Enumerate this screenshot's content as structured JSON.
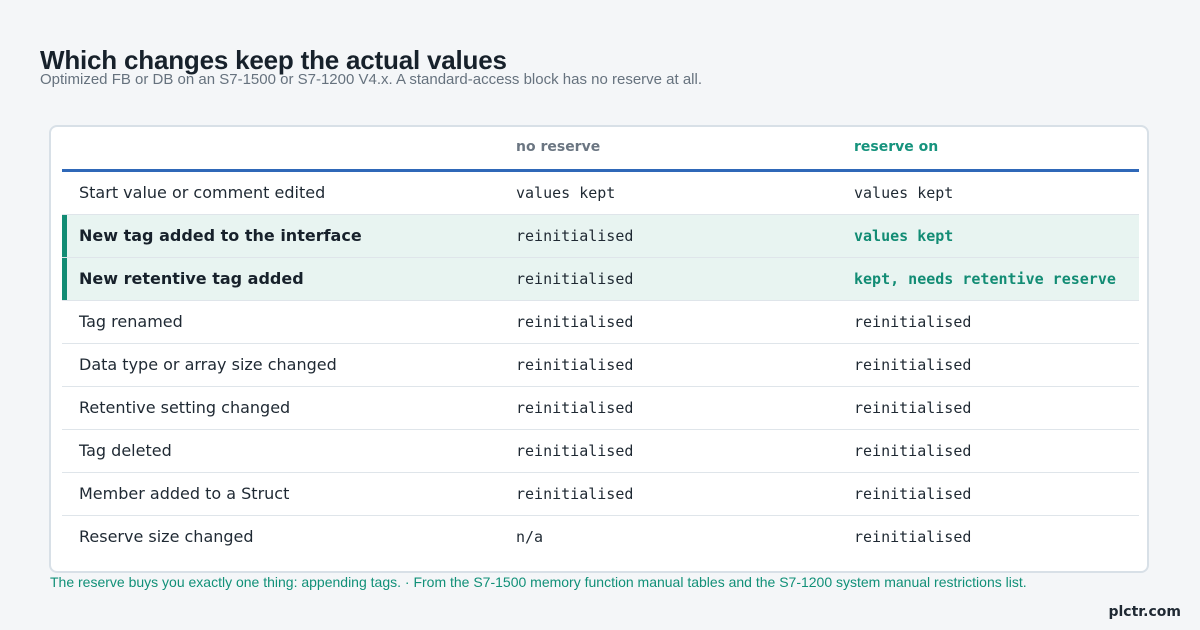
{
  "page": {
    "title": "Which changes keep the actual values",
    "subtitle": "Optimized FB or DB on an S7-1500 or S7-1200 V4.x. A standard-access block has no reserve at all.",
    "footer_note": "The reserve buys you exactly one thing: appending tags. · From the S7-1500 memory function manual tables and the S7-1200 system manual restrictions list.",
    "brand": "plctr.com"
  },
  "colors": {
    "background": "#f4f6f8",
    "card": "#ffffff",
    "header_rule": "#2f68b8",
    "accent_green": "#128c74",
    "highlight_row": "#e8f4f1",
    "muted_text": "#66727e"
  },
  "table": {
    "headers": {
      "change": "",
      "no_reserve": "no reserve",
      "reserve_on": "reserve on"
    },
    "rows": [
      {
        "change": "Start value or comment edited",
        "no_reserve": "values kept",
        "reserve_on": "values kept",
        "highlight": false
      },
      {
        "change": "New tag added to the interface",
        "no_reserve": "reinitialised",
        "reserve_on": "values kept",
        "highlight": true
      },
      {
        "change": "New retentive tag added",
        "no_reserve": "reinitialised",
        "reserve_on": "kept, needs retentive reserve",
        "highlight": true
      },
      {
        "change": "Tag renamed",
        "no_reserve": "reinitialised",
        "reserve_on": "reinitialised",
        "highlight": false
      },
      {
        "change": "Data type or array size changed",
        "no_reserve": "reinitialised",
        "reserve_on": "reinitialised",
        "highlight": false
      },
      {
        "change": "Retentive setting changed",
        "no_reserve": "reinitialised",
        "reserve_on": "reinitialised",
        "highlight": false
      },
      {
        "change": "Tag deleted",
        "no_reserve": "reinitialised",
        "reserve_on": "reinitialised",
        "highlight": false
      },
      {
        "change": "Member added to a Struct",
        "no_reserve": "reinitialised",
        "reserve_on": "reinitialised",
        "highlight": false
      },
      {
        "change": "Reserve size changed",
        "no_reserve": "n/a",
        "reserve_on": "reinitialised",
        "highlight": false
      }
    ]
  }
}
